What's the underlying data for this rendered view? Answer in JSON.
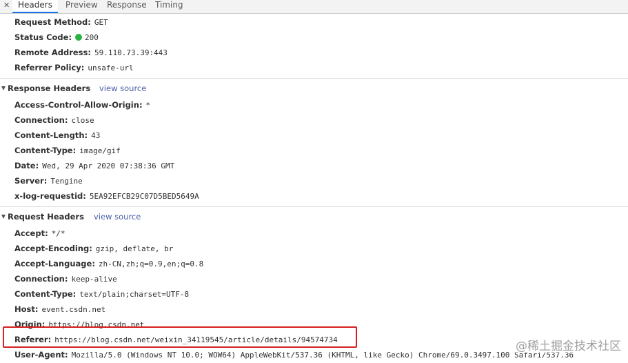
{
  "tabs": {
    "close": "✕",
    "headers": "Headers",
    "preview": "Preview",
    "response": "Response",
    "timing": "Timing"
  },
  "general": {
    "request_method": {
      "key": "Request Method:",
      "value": "GET"
    },
    "status_code": {
      "key": "Status Code:",
      "value": "200"
    },
    "remote_address": {
      "key": "Remote Address:",
      "value": "59.110.73.39:443"
    },
    "referrer_policy": {
      "key": "Referrer Policy:",
      "value": "unsafe-url"
    }
  },
  "response_headers": {
    "title": "Response Headers",
    "view_source": "view source",
    "items": [
      {
        "key": "Access-Control-Allow-Origin:",
        "value": "*"
      },
      {
        "key": "Connection:",
        "value": "close"
      },
      {
        "key": "Content-Length:",
        "value": "43"
      },
      {
        "key": "Content-Type:",
        "value": "image/gif"
      },
      {
        "key": "Date:",
        "value": "Wed, 29 Apr 2020 07:38:36 GMT"
      },
      {
        "key": "Server:",
        "value": "Tengine"
      },
      {
        "key": "x-log-requestid:",
        "value": "5EA92EFCB29C07D5BED5649A"
      }
    ]
  },
  "request_headers": {
    "title": "Request Headers",
    "view_source": "view source",
    "items": [
      {
        "key": "Accept:",
        "value": "*/*"
      },
      {
        "key": "Accept-Encoding:",
        "value": "gzip, deflate, br"
      },
      {
        "key": "Accept-Language:",
        "value": "zh-CN,zh;q=0.9,en;q=0.8"
      },
      {
        "key": "Connection:",
        "value": "keep-alive"
      },
      {
        "key": "Content-Type:",
        "value": "text/plain;charset=UTF-8"
      },
      {
        "key": "Host:",
        "value": "event.csdn.net"
      },
      {
        "key": "Origin:",
        "value": "https://blog.csdn.net"
      },
      {
        "key": "Referer:",
        "value": "https://blog.csdn.net/weixin_34119545/article/details/94574734"
      },
      {
        "key": "User-Agent:",
        "value": "Mozilla/5.0 (Windows NT 10.0; WOW64) AppleWebKit/537.36 (KHTML, like Gecko) Chrome/69.0.3497.100 Safari/537.36"
      }
    ]
  },
  "watermark": "@稀土掘金技术社区",
  "colors": {
    "status_ok": "#2bb341",
    "highlight": "#d42020",
    "link": "#4a5ea8",
    "tab_active_underline": "#1a73e8"
  }
}
